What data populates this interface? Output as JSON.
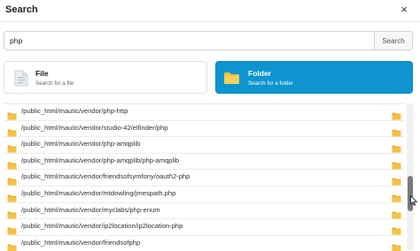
{
  "header": {
    "title": "Search",
    "close_glyph": "×"
  },
  "search": {
    "value": "php",
    "button_label": "Search"
  },
  "cards": {
    "file": {
      "title": "File",
      "subtitle": "Search for a file",
      "icon": "file-icon"
    },
    "folder": {
      "title": "Folder",
      "subtitle": "Search for a folder",
      "icon": "folder-icon",
      "active": true
    }
  },
  "results": [
    "/public_html/mautic/vendor/php-http",
    "/public_html/mautic/vendor/studio-42/elfinder/php",
    "/public_html/mautic/vendor/php-amqplib",
    "/public_html/mautic/vendor/php-amqplib/php-amqplib",
    "/public_html/mautic/vendor/friendsofsymfony/oauth2-php",
    "/public_html/mautic/vendor/mtdowling/jmespath.php",
    "/public_html/mautic/vendor/myclabs/php-enum",
    "/public_html/mautic/vendor/ip2location/ip2location-php",
    "/public_html/mautic/vendor/friendsofphp"
  ],
  "colors": {
    "accent": "#0e95cf",
    "folder": "#f5c242"
  },
  "scroll": {
    "position": 0.6
  }
}
